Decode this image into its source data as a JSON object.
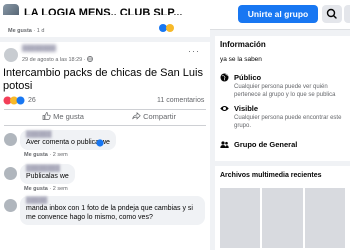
{
  "header": {
    "group_title": "LA LOGIA MENS,, CLUB SLP...",
    "join_label": "Unirte al grupo"
  },
  "previous_post": {
    "like_label": "Me gusta",
    "time": "1 d"
  },
  "post": {
    "date": "29 de agosto a las 18:29",
    "text": "Intercambio packs de chicas de San Luis potosi",
    "reaction_count": "26",
    "comments_count": "11 comentarios",
    "like_label": "Me gusta",
    "share_label": "Compartir"
  },
  "comments": [
    {
      "text": "Aver comenta o publica we",
      "like_label": "Me gusta",
      "time": "2 sem"
    },
    {
      "text": "Publicalas we",
      "like_label": "Me gusta",
      "time": "2 sem"
    },
    {
      "text": "manda inbox con 1 foto de la pndeja que cambias y si me convence hago lo mismo, como ves?"
    }
  ],
  "info": {
    "title": "Información",
    "description": "ya se la saben",
    "public_title": "Público",
    "public_text": "Cualquier persona puede ver quién pertenece al grupo y lo que se publica",
    "visible_title": "Visible",
    "visible_text": "Cualquier persona puede encontrar este grupo.",
    "general_title": "Grupo de General"
  },
  "media": {
    "title": "Archivos multimedia recientes"
  },
  "colors": {
    "accent": "#1877f2",
    "background": "#f0f2f5"
  }
}
